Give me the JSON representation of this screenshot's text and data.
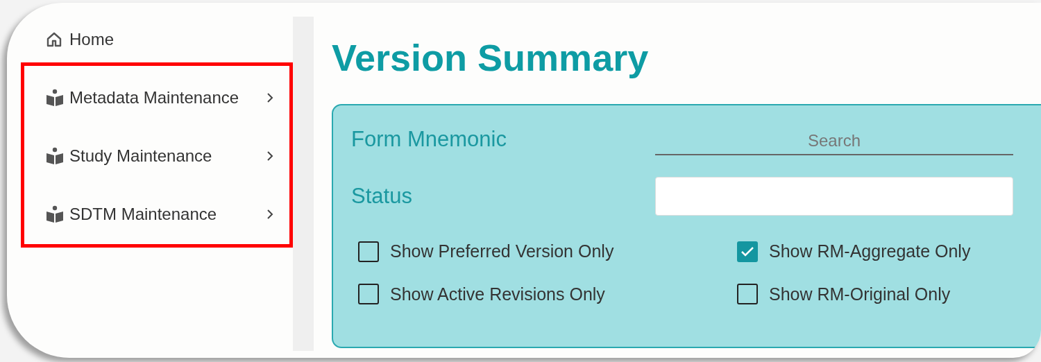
{
  "sidebar": {
    "items": [
      {
        "label": "Home",
        "kind": "home",
        "has_submenu": false,
        "highlighted": false
      },
      {
        "label": "Metadata Maintenance",
        "kind": "section",
        "has_submenu": true,
        "highlighted": true
      },
      {
        "label": "Study Maintenance",
        "kind": "section",
        "has_submenu": true,
        "highlighted": true
      },
      {
        "label": "SDTM Maintenance",
        "kind": "section",
        "has_submenu": true,
        "highlighted": true
      }
    ]
  },
  "page_title": "Version Summary",
  "filters": {
    "form_mnemonic": {
      "label": "Form Mnemonic",
      "placeholder": "Search"
    },
    "status": {
      "label": "Status"
    },
    "checkboxes": [
      {
        "label": "Show Preferred Version Only",
        "checked": false
      },
      {
        "label": "Show RM-Aggregate Only",
        "checked": true
      },
      {
        "label": "Show Active Revisions Only",
        "checked": false
      },
      {
        "label": "Show RM-Original Only",
        "checked": false
      }
    ]
  }
}
